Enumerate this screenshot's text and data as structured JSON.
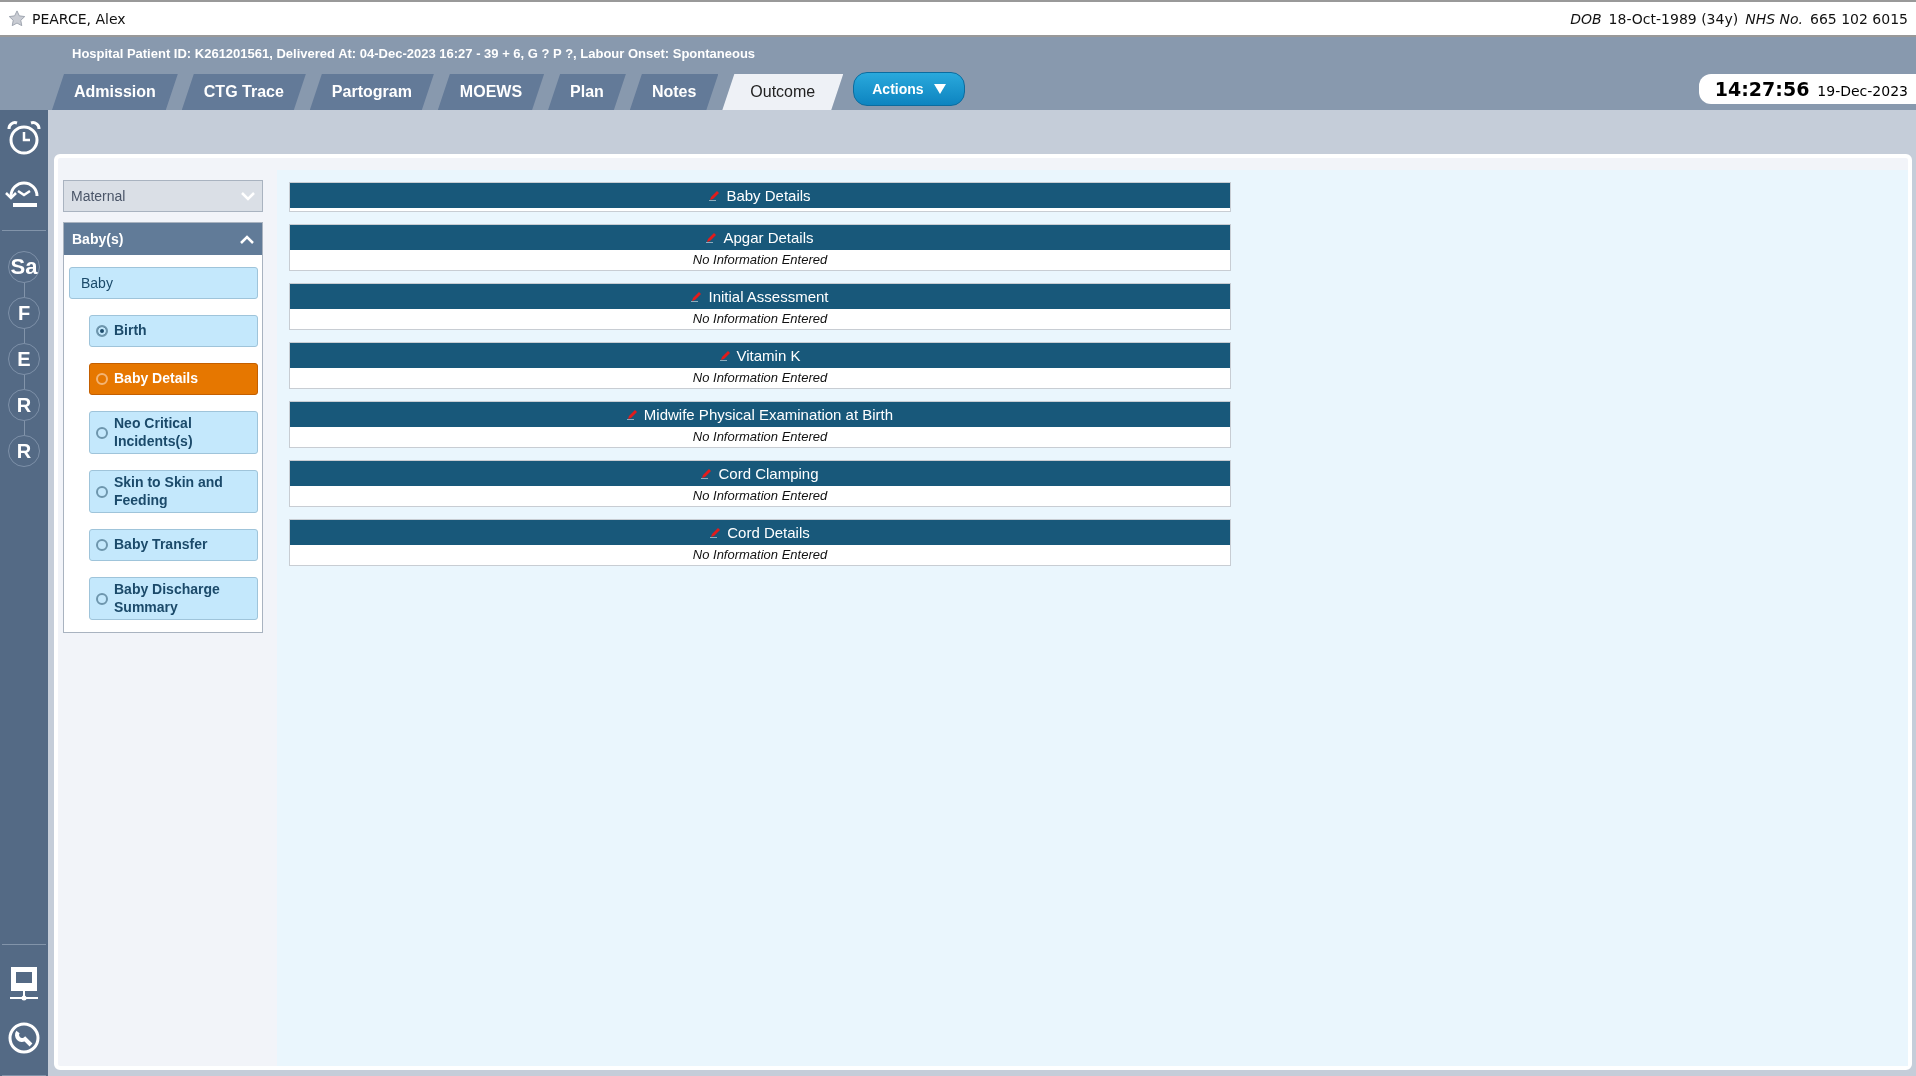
{
  "patient": {
    "name": "PEARCE, Alex",
    "dob_label": "DOB",
    "dob": "18-Oct-1989 (34y)",
    "nhs_label": "NHS No.",
    "nhs": "665 102 6015"
  },
  "info_line": "Hospital Patient ID: K261201561, Delivered At: 04-Dec-2023 16:27 - 39 + 6, G ? P ?,   Labour Onset: Spontaneous",
  "tabs": [
    {
      "label": "Admission",
      "selected": false
    },
    {
      "label": "CTG Trace",
      "selected": false
    },
    {
      "label": "Partogram",
      "selected": false
    },
    {
      "label": "MOEWS",
      "selected": false
    },
    {
      "label": "Plan",
      "selected": false
    },
    {
      "label": "Notes",
      "selected": false
    },
    {
      "label": "Outcome",
      "selected": true
    }
  ],
  "actions_button": "Actions",
  "clock": {
    "time": "14:27:56",
    "date": "19-Dec-2023"
  },
  "rail_letters": [
    "Sa",
    "F",
    "E",
    "R",
    "R"
  ],
  "sidebar": {
    "sections": [
      {
        "label": "Maternal",
        "expanded": false
      },
      {
        "label": "Baby(s)",
        "expanded": true,
        "items": [
          {
            "kind": "group",
            "label": "Baby"
          },
          {
            "kind": "radio",
            "label": "Birth",
            "selected": false,
            "checked": true
          },
          {
            "kind": "radio",
            "label": "Baby Details",
            "selected": true,
            "checked": false
          },
          {
            "kind": "radio",
            "label": "Neo Critical Incidents(s)",
            "selected": false,
            "checked": false
          },
          {
            "kind": "radio",
            "label": "Skin to Skin and Feeding",
            "selected": false,
            "checked": false
          },
          {
            "kind": "radio",
            "label": "Baby Transfer",
            "selected": false,
            "checked": false
          },
          {
            "kind": "radio",
            "label": "Baby Discharge Summary",
            "selected": false,
            "checked": false
          }
        ]
      }
    ]
  },
  "sections": [
    {
      "title": "Baby Details"
    },
    {
      "title": "Apgar Details",
      "body": "No Information Entered"
    },
    {
      "title": "Initial Assessment",
      "body": "No Information Entered"
    },
    {
      "title": "Vitamin K",
      "body": "No Information Entered"
    },
    {
      "title": "Midwife Physical Examination at Birth",
      "body": "No Information Entered"
    },
    {
      "title": "Cord Clamping",
      "body": "No Information Entered"
    },
    {
      "title": "Cord Details",
      "body": "No Information Entered"
    }
  ]
}
